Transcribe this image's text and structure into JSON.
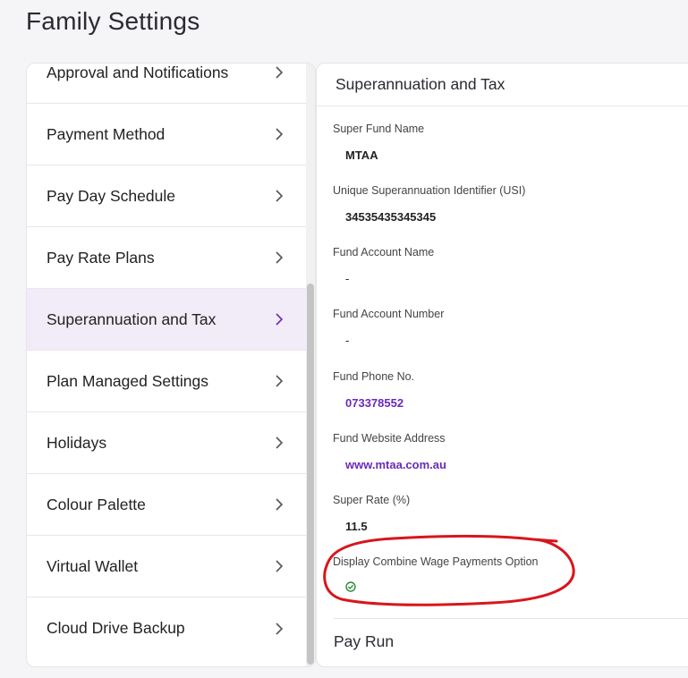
{
  "page": {
    "title": "Family Settings"
  },
  "sidebar": {
    "items": [
      {
        "label": "Approval and Notifications",
        "active": false
      },
      {
        "label": "Payment Method",
        "active": false
      },
      {
        "label": "Pay Day Schedule",
        "active": false
      },
      {
        "label": "Pay Rate Plans",
        "active": false
      },
      {
        "label": "Superannuation and Tax",
        "active": true
      },
      {
        "label": "Plan Managed Settings",
        "active": false
      },
      {
        "label": "Holidays",
        "active": false
      },
      {
        "label": "Colour Palette",
        "active": false
      },
      {
        "label": "Virtual Wallet",
        "active": false
      },
      {
        "label": "Cloud Drive Backup",
        "active": false
      }
    ]
  },
  "detail": {
    "header": "Superannuation and Tax",
    "fields": {
      "super_fund_name": {
        "label": "Super Fund Name",
        "value": "MTAA"
      },
      "usi": {
        "label": "Unique Superannuation Identifier (USI)",
        "value": "34535435345345"
      },
      "fund_account_name": {
        "label": "Fund Account Name",
        "value": "-"
      },
      "fund_account_number": {
        "label": "Fund Account Number",
        "value": "-"
      },
      "fund_phone": {
        "label": "Fund Phone No.",
        "value": "073378552"
      },
      "fund_website": {
        "label": "Fund Website Address",
        "value": "www.mtaa.com.au"
      },
      "super_rate": {
        "label": "Super Rate (%)",
        "value": "11.5"
      },
      "combine_wage": {
        "label": "Display Combine Wage Payments Option",
        "checked": true
      }
    },
    "next_section": "Pay Run"
  },
  "colors": {
    "accent": "#6a2ab8",
    "active_bg": "#f1ecf8",
    "check": "#2e8b3a",
    "annotation": "#d8161b"
  }
}
